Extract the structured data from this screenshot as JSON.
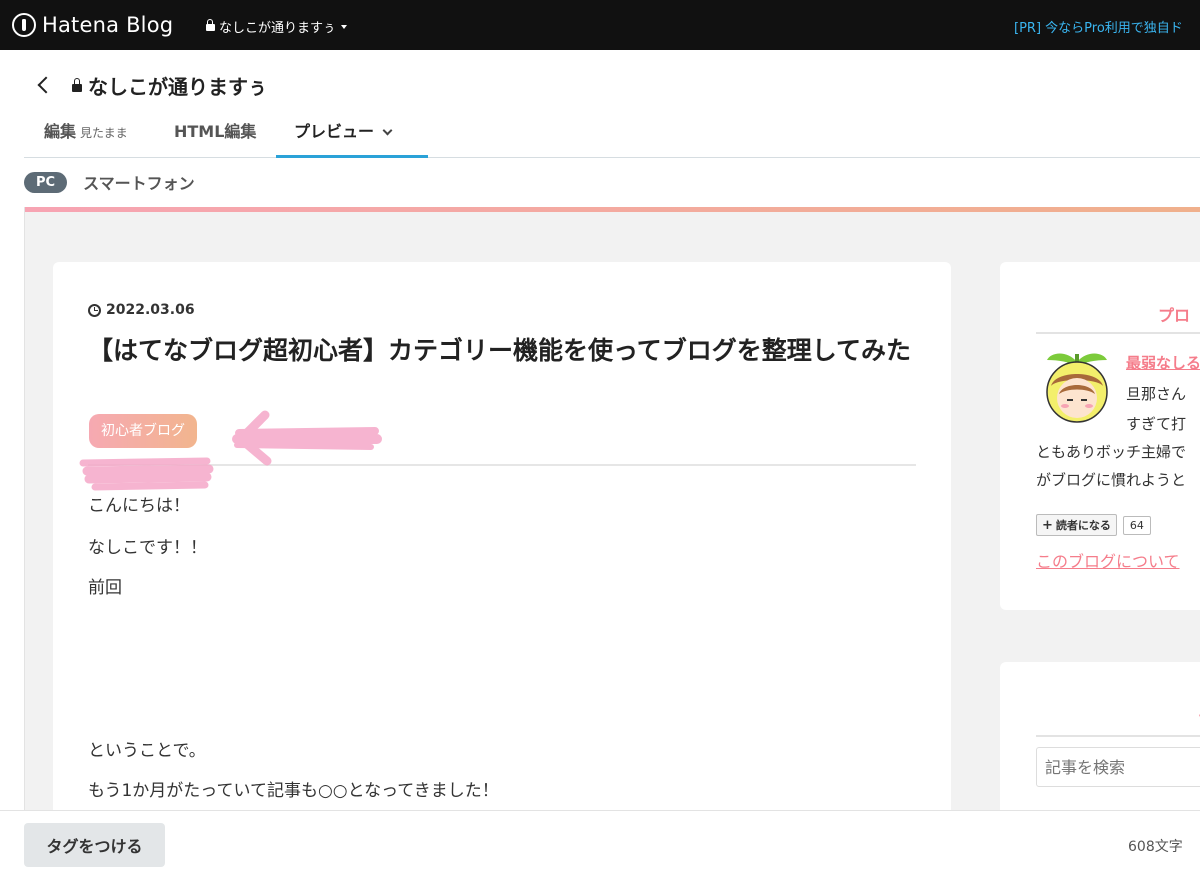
{
  "topbar": {
    "logo_text": "Hatena Blog",
    "blog_name": "なしこが通りますぅ",
    "pr_text": "[PR] 今ならPro利用で独自ド"
  },
  "editor": {
    "title": "なしこが通りますぅ",
    "tabs": [
      {
        "label": "編集",
        "sub": "見たまま"
      },
      {
        "label": "HTML編集"
      },
      {
        "label": "プレビュー"
      }
    ],
    "device": {
      "pc": "PC",
      "smartphone": "スマートフォン"
    }
  },
  "article": {
    "date": "2022.03.06",
    "title": "【はてなブログ超初心者】カテゴリー機能を使ってブログを整理してみた",
    "category": "初心者ブログ",
    "paragraphs": [
      "こんにちは！",
      "なしこです！！",
      "前回",
      "ということで。",
      "もう1か月がたっていて記事も○○となってきました！"
    ]
  },
  "sidebar": {
    "profile_heading": "プロ",
    "profile_name": "最弱なしる",
    "profile_desc": [
      "旦那さん",
      "すぎて打",
      "ともありボッチ主婦で",
      "がブログに慣れようと"
    ],
    "subscribe_label": "読者になる",
    "subscriber_count": "64",
    "about_link": "このブログについて",
    "search_heading": "そ",
    "search_placeholder": "記事を検索"
  },
  "footer": {
    "tag_button": "タグをつける",
    "char_count": "608文字"
  },
  "colors": {
    "accent_pink": "#f57d8b",
    "tab_underline": "#2aa2d8",
    "pr_link": "#3ab5f0"
  }
}
